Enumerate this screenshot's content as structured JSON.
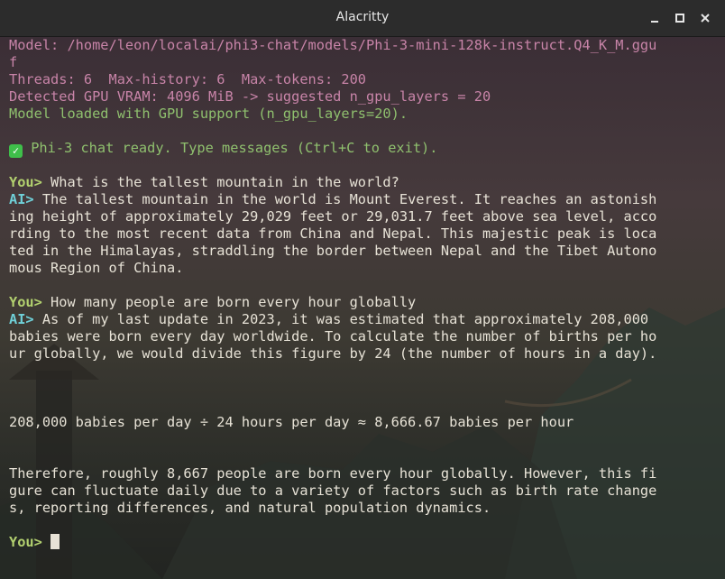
{
  "window": {
    "title": "Alacritty"
  },
  "colors": {
    "pink": "#c884a8",
    "green": "#8fc06e",
    "you_prompt": "#b2d06f",
    "ai_prompt": "#6fd0d8",
    "text": "#e7e2d6"
  },
  "terminal": {
    "header": [
      "Model: /home/leon/localai/phi3-chat/models/Phi-3-mini-128k-instruct.Q4_K_M.ggu",
      "f",
      "Threads: 6  Max-history: 6  Max-tokens: 200",
      "Detected GPU VRAM: 4096 MiB -> suggested n_gpu_layers = 20"
    ],
    "loaded": "Model loaded with GPU support (n_gpu_layers=20).",
    "ready_icon": "check-mark-button-icon",
    "ready": " Phi-3 chat ready. Type messages (Ctrl+C to exit).",
    "you_prompt": "You>",
    "ai_prompt": "AI>",
    "q1": " What is the tallest mountain in the world?",
    "a1_first": " The tallest mountain in the world is Mount Everest. It reaches an astonish",
    "a1_rest": [
      "ing height of approximately 29,029 feet or 29,031.7 feet above sea level, acco",
      "rding to the most recent data from China and Nepal. This majestic peak is loca",
      "ted in the Himalayas, straddling the border between Nepal and the Tibet Autono",
      "mous Region of China."
    ],
    "q2": " How many people are born every hour globally",
    "a2_first": " As of my last update in 2023, it was estimated that approximately 208,000",
    "a2_rest": [
      "babies were born every day worldwide. To calculate the number of births per ho",
      "ur globally, we would divide this figure by 24 (the number of hours in a day)."
    ],
    "calc": "208,000 babies per day ÷ 24 hours per day ≈ 8,666.67 babies per hour",
    "conclusion": [
      "Therefore, roughly 8,667 people are born every hour globally. However, this fi",
      "gure can fluctuate daily due to a variety of factors such as birth rate change",
      "s, reporting differences, and natural population dynamics."
    ],
    "input_value": ""
  }
}
